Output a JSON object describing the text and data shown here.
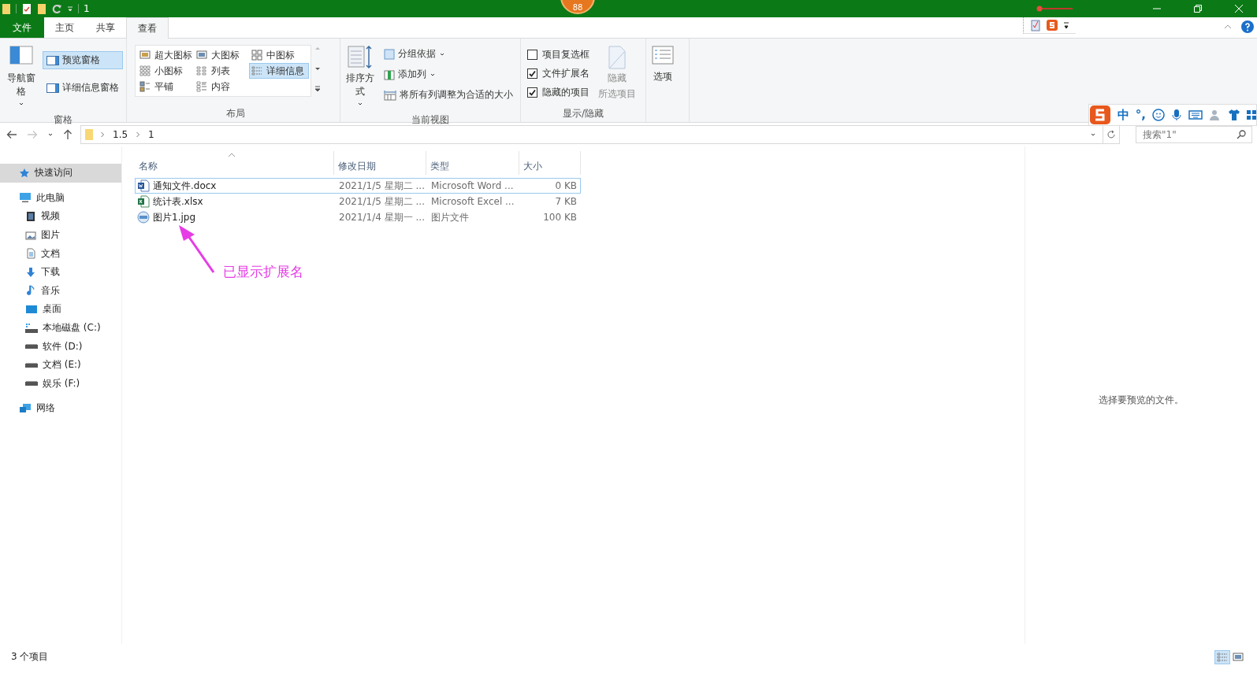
{
  "title_bar": {
    "title": "1",
    "badge": "88"
  },
  "ribbon_tabs": [
    {
      "label": "文件",
      "kind": "file",
      "selected": false
    },
    {
      "label": "主页",
      "kind": "tab",
      "selected": false
    },
    {
      "label": "共享",
      "kind": "tab",
      "selected": false
    },
    {
      "label": "查看",
      "kind": "tab",
      "selected": true
    }
  ],
  "ime_bar": {
    "mode": "中",
    "punct": "°,"
  },
  "ribbon": {
    "panes": {
      "label": "窗格",
      "nav": "导航窗格",
      "preview": {
        "label": "预览窗格",
        "selected": true
      },
      "details": {
        "label": "详细信息窗格",
        "selected": false
      }
    },
    "layout": {
      "label": "布局",
      "items": [
        {
          "label": "超大图标",
          "kind": "xl",
          "selected": false
        },
        {
          "label": "大图标",
          "kind": "large",
          "selected": false
        },
        {
          "label": "中图标",
          "kind": "medium",
          "selected": false
        },
        {
          "label": "小图标",
          "kind": "small",
          "selected": false
        },
        {
          "label": "列表",
          "kind": "list",
          "selected": false
        },
        {
          "label": "详细信息",
          "kind": "details",
          "selected": true
        },
        {
          "label": "平铺",
          "kind": "tiles",
          "selected": false
        },
        {
          "label": "内容",
          "kind": "content",
          "selected": false
        }
      ]
    },
    "current_view": {
      "label": "当前视图",
      "sort": "排序方式",
      "group": "分组依据",
      "add_column": "添加列",
      "fit": "将所有列调整为合适的大小"
    },
    "show_hide": {
      "label": "显示/隐藏",
      "checks": [
        {
          "label": "项目复选框",
          "checked": false
        },
        {
          "label": "文件扩展名",
          "checked": true
        },
        {
          "label": "隐藏的项目",
          "checked": true
        }
      ],
      "hide_selected": {
        "label_lines": [
          "隐藏",
          "所选项目"
        ],
        "disabled": true
      }
    },
    "options": "选项"
  },
  "address": {
    "crumbs": [
      "1.5",
      "1"
    ],
    "search_placeholder": "搜索\"1\""
  },
  "sidebar": {
    "items": [
      {
        "label": "快速访问",
        "kind": "star",
        "selected": true
      },
      {
        "label": "此电脑",
        "kind": "pc",
        "selected": false,
        "children": [
          {
            "label": "视频",
            "kind": "video",
            "selected": false
          },
          {
            "label": "图片",
            "kind": "pictures",
            "selected": false
          },
          {
            "label": "文档",
            "kind": "documents",
            "selected": false
          },
          {
            "label": "下载",
            "kind": "download",
            "selected": false
          },
          {
            "label": "音乐",
            "kind": "music",
            "selected": false
          },
          {
            "label": "桌面",
            "kind": "desktop",
            "selected": false
          },
          {
            "label": "本地磁盘 (C:)",
            "kind": "system",
            "selected": false
          },
          {
            "label": "软件 (D:)",
            "kind": "drive",
            "selected": false
          },
          {
            "label": "文档 (E:)",
            "kind": "drive",
            "selected": false
          },
          {
            "label": "娱乐 (F:)",
            "kind": "drive",
            "selected": false
          }
        ]
      },
      {
        "label": "网络",
        "kind": "network",
        "selected": false
      }
    ]
  },
  "table": {
    "columns": [
      "名称",
      "修改日期",
      "类型",
      "大小"
    ],
    "rows": [
      {
        "kind": "word",
        "selected": true,
        "cells": [
          "通知文件.docx",
          "2021/1/5 星期二 ...",
          "Microsoft Word ...",
          "0 KB"
        ]
      },
      {
        "kind": "excel",
        "selected": false,
        "cells": [
          "统计表.xlsx",
          "2021/1/5 星期二 ...",
          "Microsoft Excel ...",
          "7 KB"
        ]
      },
      {
        "kind": "image",
        "selected": false,
        "cells": [
          "图片1.jpg",
          "2021/1/4 星期一 ...",
          "图片文件",
          "100 KB"
        ]
      }
    ]
  },
  "annotation": "已显示扩展名",
  "preview_pane": {
    "message": "选择要预览的文件。"
  },
  "status_bar": {
    "count": "3 个项目",
    "view_toggles": [
      {
        "kind": "details",
        "selected": true
      },
      {
        "kind": "thumbnails",
        "selected": false
      }
    ]
  }
}
